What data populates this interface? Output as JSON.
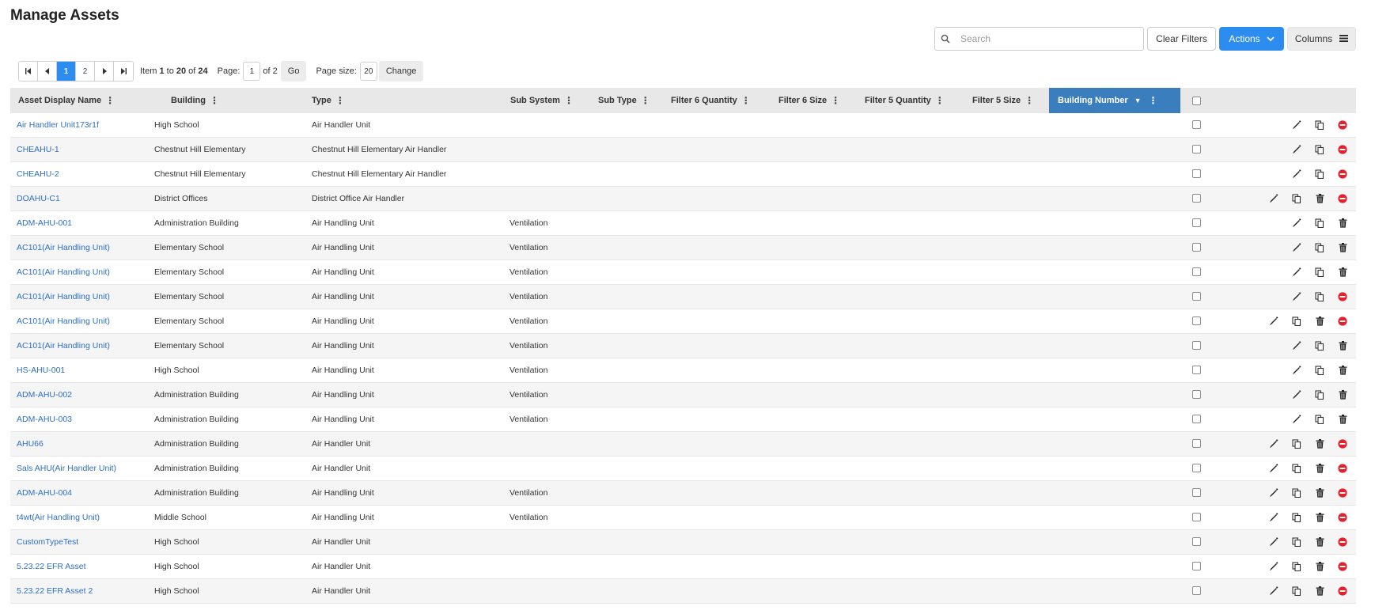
{
  "page": {
    "title": "Manage Assets"
  },
  "toolbar": {
    "search_placeholder": "Search",
    "clear_filters": "Clear Filters",
    "actions": "Actions",
    "columns": "Columns"
  },
  "pager": {
    "pages": [
      "1",
      "2"
    ],
    "active_page": "1",
    "item_prefix": "Item ",
    "item_from": "1",
    "item_to_word": " to ",
    "item_to": "20",
    "item_of_word": " of ",
    "item_total": "24",
    "page_label": "Page:",
    "page_value": "1",
    "of_pages": "of 2",
    "go": "Go",
    "page_size_label": "Page size:",
    "page_size_value": "20",
    "change": "Change"
  },
  "columns": [
    "Asset Display Name",
    "Building",
    "Type",
    "Sub System",
    "Sub Type",
    "Filter 6 Quantity",
    "Filter 6 Size",
    "Filter 5 Quantity",
    "Filter 5 Size",
    "Building Number"
  ],
  "sort_indicator": "▼",
  "rows": [
    {
      "name": "Air Handler Unit173r1f",
      "building": "High School",
      "type": "Air Handler Unit",
      "sub_system": "",
      "actions": [
        "edit",
        "copy",
        "remove"
      ]
    },
    {
      "name": "CHEAHU-1",
      "building": "Chestnut Hill Elementary",
      "type": "Chestnut Hill Elementary Air Handler",
      "sub_system": "",
      "actions": [
        "edit",
        "copy",
        "remove"
      ]
    },
    {
      "name": "CHEAHU-2",
      "building": "Chestnut Hill Elementary",
      "type": "Chestnut Hill Elementary Air Handler",
      "sub_system": "",
      "actions": [
        "edit",
        "copy",
        "remove"
      ]
    },
    {
      "name": "DOAHU-C1",
      "building": "District Offices",
      "type": "District Office Air Handler",
      "sub_system": "",
      "actions": [
        "edit",
        "copy",
        "delete",
        "remove"
      ]
    },
    {
      "name": "ADM-AHU-001",
      "building": "Administration Building",
      "type": "Air Handling Unit",
      "sub_system": "Ventilation",
      "actions": [
        "edit",
        "copy",
        "delete"
      ]
    },
    {
      "name": "AC101(Air Handling Unit)",
      "building": "Elementary School",
      "type": "Air Handling Unit",
      "sub_system": "Ventilation",
      "actions": [
        "edit",
        "copy",
        "delete"
      ]
    },
    {
      "name": "AC101(Air Handling Unit)",
      "building": "Elementary School",
      "type": "Air Handling Unit",
      "sub_system": "Ventilation",
      "actions": [
        "edit",
        "copy",
        "delete"
      ]
    },
    {
      "name": "AC101(Air Handling Unit)",
      "building": "Elementary School",
      "type": "Air Handling Unit",
      "sub_system": "Ventilation",
      "actions": [
        "edit",
        "copy",
        "remove"
      ]
    },
    {
      "name": "AC101(Air Handling Unit)",
      "building": "Elementary School",
      "type": "Air Handling Unit",
      "sub_system": "Ventilation",
      "actions": [
        "edit",
        "copy",
        "delete",
        "remove"
      ]
    },
    {
      "name": "AC101(Air Handling Unit)",
      "building": "Elementary School",
      "type": "Air Handling Unit",
      "sub_system": "Ventilation",
      "actions": [
        "edit",
        "copy",
        "delete"
      ]
    },
    {
      "name": "HS-AHU-001",
      "building": "High School",
      "type": "Air Handling Unit",
      "sub_system": "Ventilation",
      "actions": [
        "edit",
        "copy",
        "delete"
      ]
    },
    {
      "name": "ADM-AHU-002",
      "building": "Administration Building",
      "type": "Air Handling Unit",
      "sub_system": "Ventilation",
      "actions": [
        "edit",
        "copy",
        "delete"
      ]
    },
    {
      "name": "ADM-AHU-003",
      "building": "Administration Building",
      "type": "Air Handling Unit",
      "sub_system": "Ventilation",
      "actions": [
        "edit",
        "copy",
        "delete"
      ]
    },
    {
      "name": "AHU66",
      "building": "Administration Building",
      "type": "Air Handler Unit",
      "sub_system": "",
      "actions": [
        "edit",
        "copy",
        "delete",
        "remove"
      ]
    },
    {
      "name": "Sals AHU(Air Handler Unit)",
      "building": "Administration Building",
      "type": "Air Handler Unit",
      "sub_system": "",
      "actions": [
        "edit",
        "copy",
        "delete",
        "remove"
      ]
    },
    {
      "name": "ADM-AHU-004",
      "building": "Administration Building",
      "type": "Air Handling Unit",
      "sub_system": "Ventilation",
      "actions": [
        "edit",
        "copy",
        "delete",
        "remove"
      ]
    },
    {
      "name": "t4wt(Air Handling Unit)",
      "building": "Middle School",
      "type": "Air Handling Unit",
      "sub_system": "Ventilation",
      "actions": [
        "edit",
        "copy",
        "delete",
        "remove"
      ]
    },
    {
      "name": "CustomTypeTest",
      "building": "High School",
      "type": "Air Handler Unit",
      "sub_system": "",
      "actions": [
        "edit",
        "copy",
        "delete",
        "remove"
      ]
    },
    {
      "name": "5.23.22 EFR Asset",
      "building": "High School",
      "type": "Air Handler Unit",
      "sub_system": "",
      "actions": [
        "edit",
        "copy",
        "delete",
        "remove"
      ]
    },
    {
      "name": "5.23.22 EFR Asset 2",
      "building": "High School",
      "type": "Air Handler Unit",
      "sub_system": "",
      "actions": [
        "edit",
        "copy",
        "delete",
        "remove"
      ]
    }
  ],
  "colors": {
    "accent": "#2d8cf0",
    "sorted_header": "#3a7ebd",
    "link": "#2d6fc7",
    "remove": "#e3202b"
  },
  "icons": {
    "edit": "pencil-icon",
    "copy": "copy-icon",
    "delete": "trash-icon",
    "remove": "remove-icon"
  }
}
